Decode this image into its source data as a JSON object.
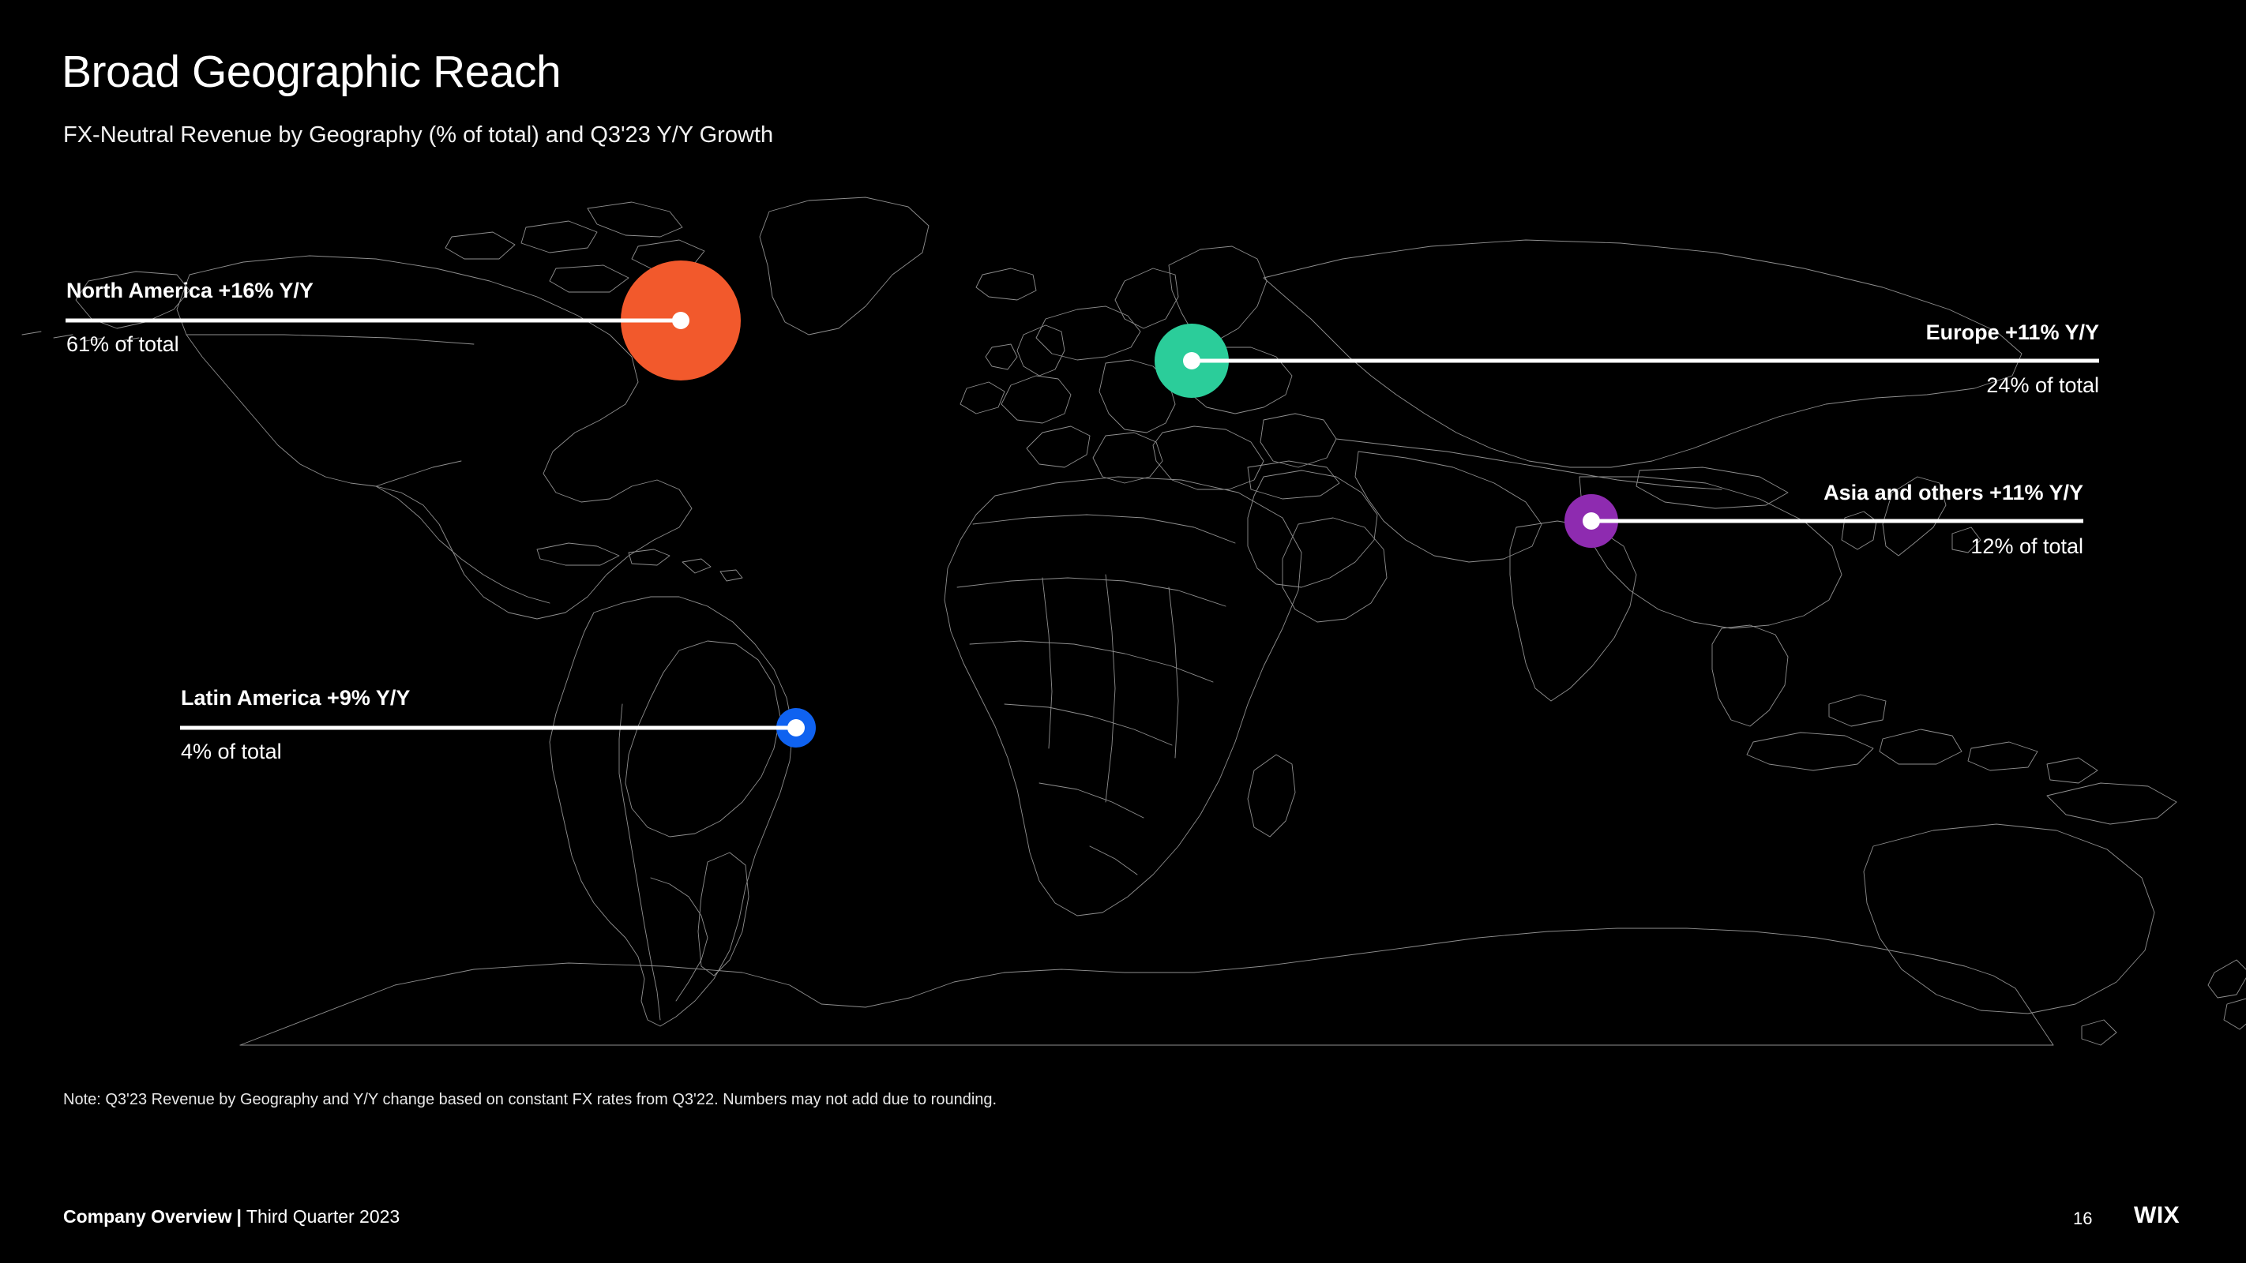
{
  "header": {
    "title": "Broad Geographic Reach",
    "subtitle": "FX-Neutral Revenue by Geography (% of total) and Q3'23 Y/Y Growth"
  },
  "footnote": "Note: Q3'23 Revenue by Geography and Y/Y change based on constant FX rates from Q3'22. Numbers may not add due to rounding.",
  "footer": {
    "deck_name": "Company Overview",
    "separator": "|",
    "period": "Third Quarter 2023",
    "page_number": "16",
    "brand": "WIX"
  },
  "chart_data": {
    "type": "bubble_map",
    "title": "Broad Geographic Reach",
    "subtitle": "FX-Neutral Revenue by Geography (% of total) and Q3'23 Y/Y Growth",
    "value_unit": "% of total revenue",
    "growth_unit": "% Y/Y FX-neutral growth",
    "background_color": "#000000",
    "map_outline_color": "#8f8f8f",
    "categories": [
      "North America",
      "Europe",
      "Asia and others",
      "Latin America"
    ],
    "values": [
      61,
      24,
      12,
      4
    ],
    "growth": [
      16,
      11,
      11,
      9
    ],
    "colors": [
      "#f2592c",
      "#2bcd9a",
      "#8e2bb0",
      "#0f62f0"
    ],
    "series": [
      {
        "name": "Share of total revenue (%)",
        "values": [
          61,
          24,
          12,
          4
        ]
      },
      {
        "name": "Y/Y growth (%)",
        "values": [
          16,
          11,
          11,
          9
        ]
      }
    ]
  },
  "regions": [
    {
      "id": "north-america",
      "head": "North America +16% Y/Y",
      "sub": "61% of total",
      "color": "#f2592c"
    },
    {
      "id": "europe",
      "head": "Europe +11% Y/Y",
      "sub": "24% of total",
      "color": "#2bcd9a"
    },
    {
      "id": "asia-and-others",
      "head": "Asia and others +11% Y/Y",
      "sub": "12% of total",
      "color": "#8e2bb0"
    },
    {
      "id": "latin-america",
      "head": "Latin America +9% Y/Y",
      "sub": "4% of total",
      "color": "#0f62f0"
    }
  ]
}
